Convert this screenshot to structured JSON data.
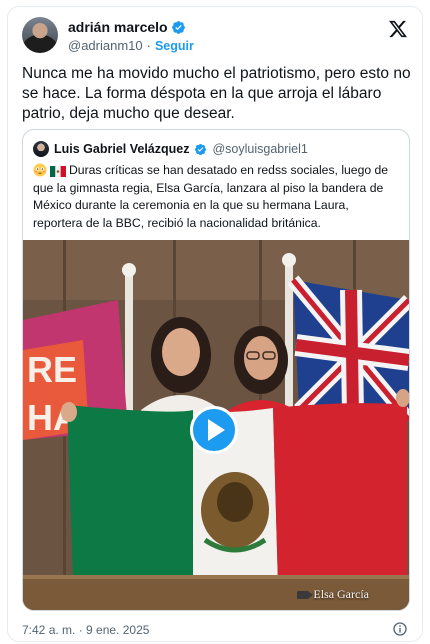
{
  "tweet": {
    "author_name": "adrián marcelo",
    "author_handle": "@adrianm10",
    "separator": "·",
    "follow_label": "Seguir",
    "text": "Nunca me ha movido mucho el patriotismo, pero esto no se hace. La forma déspota en la que arroja el lábaro patrio, deja mucho que desear.",
    "timestamp": "7:42 a. m. · 9 ene. 2025"
  },
  "quoted": {
    "author_name": "Luis Gabriel Velázquez",
    "author_handle": "@soyluisgabriel1",
    "text": "Duras críticas se han desatado en redss sociales, luego de que la gimnasta regia, Elsa García, lanzara al piso la bandera de México durante la ceremonia en la que su hermana Laura, reportera de la BBC, recibió la nacionalidad británica.",
    "media_watermark": "Elsa García"
  },
  "icons": {
    "verified": "verified-badge-icon",
    "x_logo": "x-logo-icon",
    "play": "play-icon",
    "info": "info-icon",
    "emojis": [
      "flushed-face-emoji",
      "mexico-flag-emoji"
    ]
  },
  "colors": {
    "accent": "#1d9bf0",
    "text": "#0f1419",
    "muted": "#536471",
    "border": "#cfd9de"
  }
}
